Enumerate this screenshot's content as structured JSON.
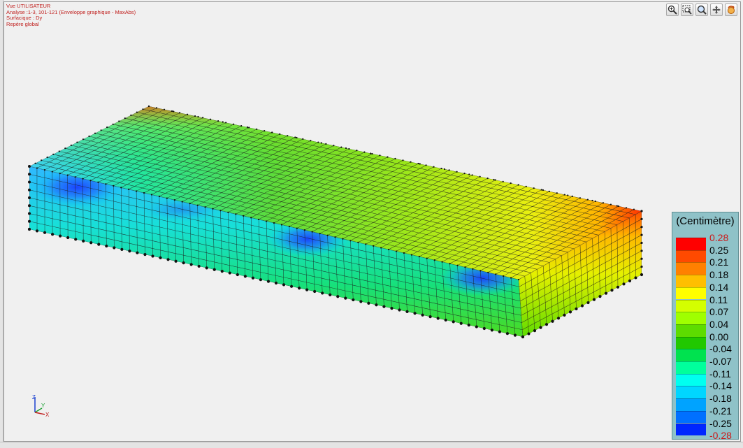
{
  "view_info": {
    "lines": [
      "Vue UTILISATEUR",
      "Analyse :1-3, 101-121 (Enveloppe graphique - MaxAbs)",
      "Surfacique : Dy",
      "Repère global"
    ]
  },
  "toolbar": {
    "buttons": [
      {
        "name": "zoom-icon-button",
        "icon": "zoom-in-icon"
      },
      {
        "name": "zoom-window-button",
        "icon": "zoom-window-icon"
      },
      {
        "name": "zoom-all-button",
        "icon": "zoom-all-icon"
      },
      {
        "name": "pan-button",
        "icon": "pan-icon"
      },
      {
        "name": "rotate-button",
        "icon": "rotate-hand-icon"
      }
    ]
  },
  "legend": {
    "title": "(Centimètre)",
    "max_label": "0.28",
    "min_label": "-0.28",
    "labels": [
      "0.25",
      "0.21",
      "0.18",
      "0.14",
      "0.11",
      "0.07",
      "0.04",
      "0.00",
      "-0.04",
      "-0.07",
      "-0.11",
      "-0.14",
      "-0.18",
      "-0.21",
      "-0.25"
    ],
    "colors": [
      "#ff0000",
      "#ff4a00",
      "#ff8000",
      "#ffbf00",
      "#ffff00",
      "#d4ff00",
      "#9fff00",
      "#5ddc00",
      "#21c800",
      "#00e24f",
      "#00ff9c",
      "#00fff0",
      "#00d6ff",
      "#00a3ff",
      "#0070ff",
      "#0026ff"
    ],
    "extreme_color": "#cc1a1a"
  },
  "axis": {
    "x": "X",
    "y": "Y",
    "z": "Z"
  },
  "colors": {
    "info_text": "#c0201e",
    "legend_bg": "#8fc2c8",
    "background": "#f0f0f0"
  }
}
